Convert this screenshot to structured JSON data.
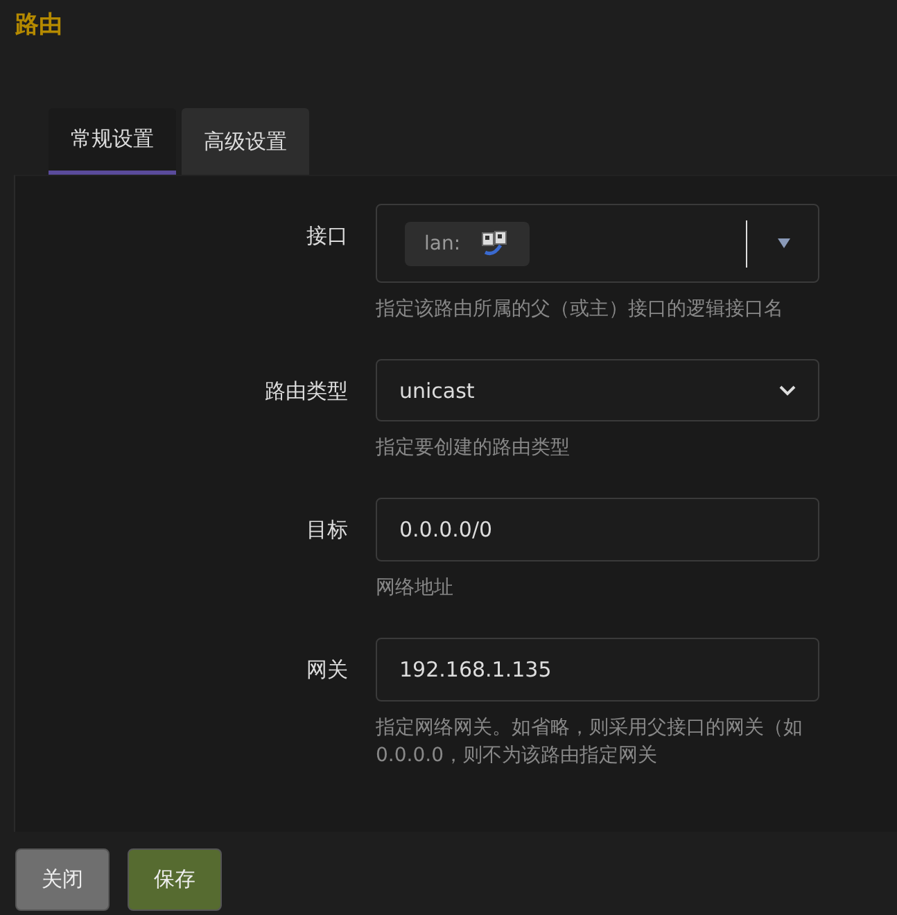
{
  "title": "路由",
  "tabs": [
    {
      "label": "常规设置",
      "selected": true
    },
    {
      "label": "高级设置",
      "selected": false
    }
  ],
  "fields": [
    {
      "kind": "tags",
      "label": "接口",
      "tag": "lan:",
      "hint_lines": [
        "指定该路由所属的父（或主）接口的逻辑接口名"
      ]
    },
    {
      "kind": "select",
      "label": "路由类型",
      "value": "unicast",
      "hint_lines": [
        "指定要创建的路由类型"
      ]
    },
    {
      "kind": "input",
      "label": "目标",
      "value": "0.0.0.0/0",
      "hint_lines": [
        "网络地址"
      ]
    },
    {
      "kind": "input",
      "label": "网关",
      "value": "192.168.1.135",
      "hint_lines": [
        "指定网络网关。如省略，则采用父接口的网关（如",
        "0.0.0.0，则不为该路由指定网关"
      ]
    }
  ],
  "buttons": [
    {
      "label": "关闭",
      "kind": "close"
    },
    {
      "label": "保存",
      "kind": "save"
    }
  ]
}
